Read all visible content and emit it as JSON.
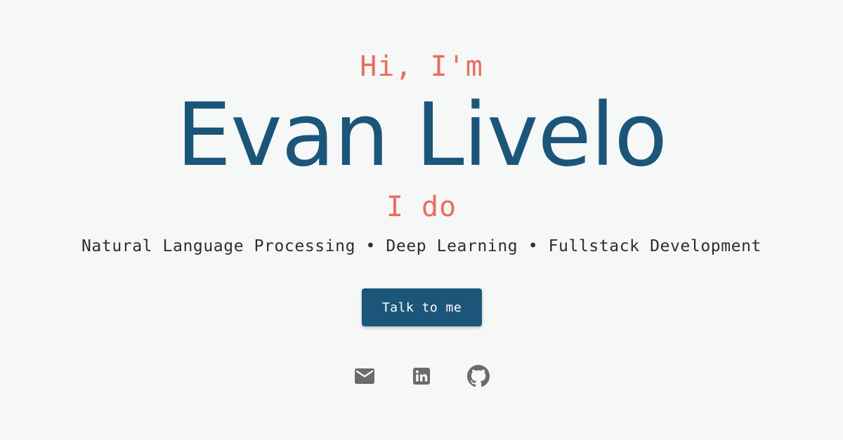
{
  "hero": {
    "greeting": "Hi, I'm",
    "name": "Evan Livelo",
    "ido": "I do",
    "skills": [
      "Natural Language Processing",
      "Deep Learning",
      "Fullstack Development"
    ],
    "separator": "•",
    "cta_label": "Talk to me"
  },
  "socials": [
    {
      "icon": "mail-icon"
    },
    {
      "icon": "linkedin-icon"
    },
    {
      "icon": "github-icon"
    }
  ],
  "colors": {
    "background": "#f6f7f7",
    "accent": "#e86d5f",
    "primary": "#1b567a",
    "text": "#2d2d2d",
    "icon": "#6b6b6b"
  }
}
